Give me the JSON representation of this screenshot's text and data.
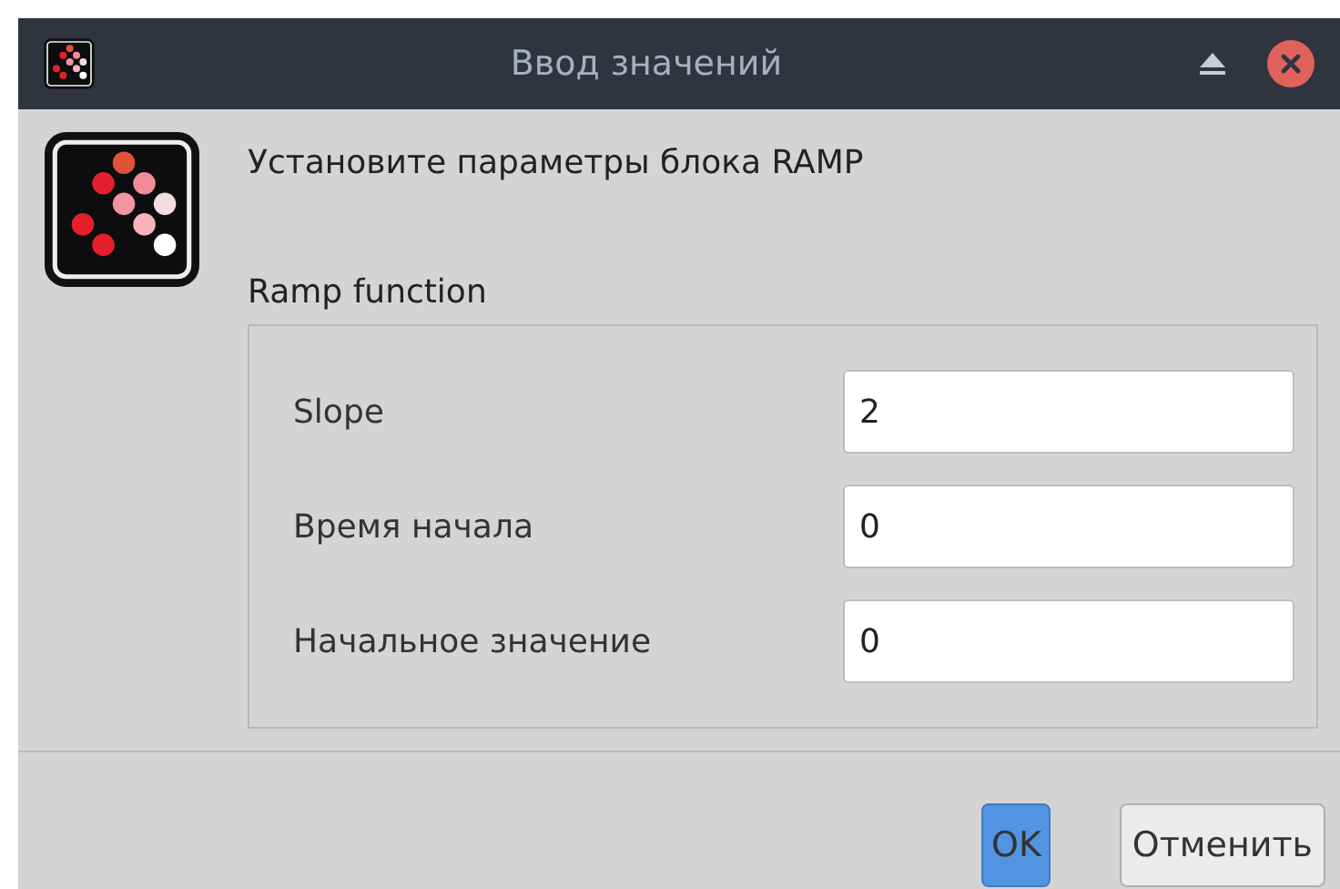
{
  "window": {
    "title": "Ввод значений"
  },
  "message": "Установите параметры блока RAMP",
  "group": {
    "title": "Ramp function",
    "fields": [
      {
        "label": "Slope",
        "value": "2"
      },
      {
        "label": "Время начала",
        "value": "0"
      },
      {
        "label": "Начальное значение",
        "value": "0"
      }
    ]
  },
  "buttons": [
    {
      "label": "OK",
      "default": true
    },
    {
      "label": "Отменить",
      "default": false
    }
  ]
}
